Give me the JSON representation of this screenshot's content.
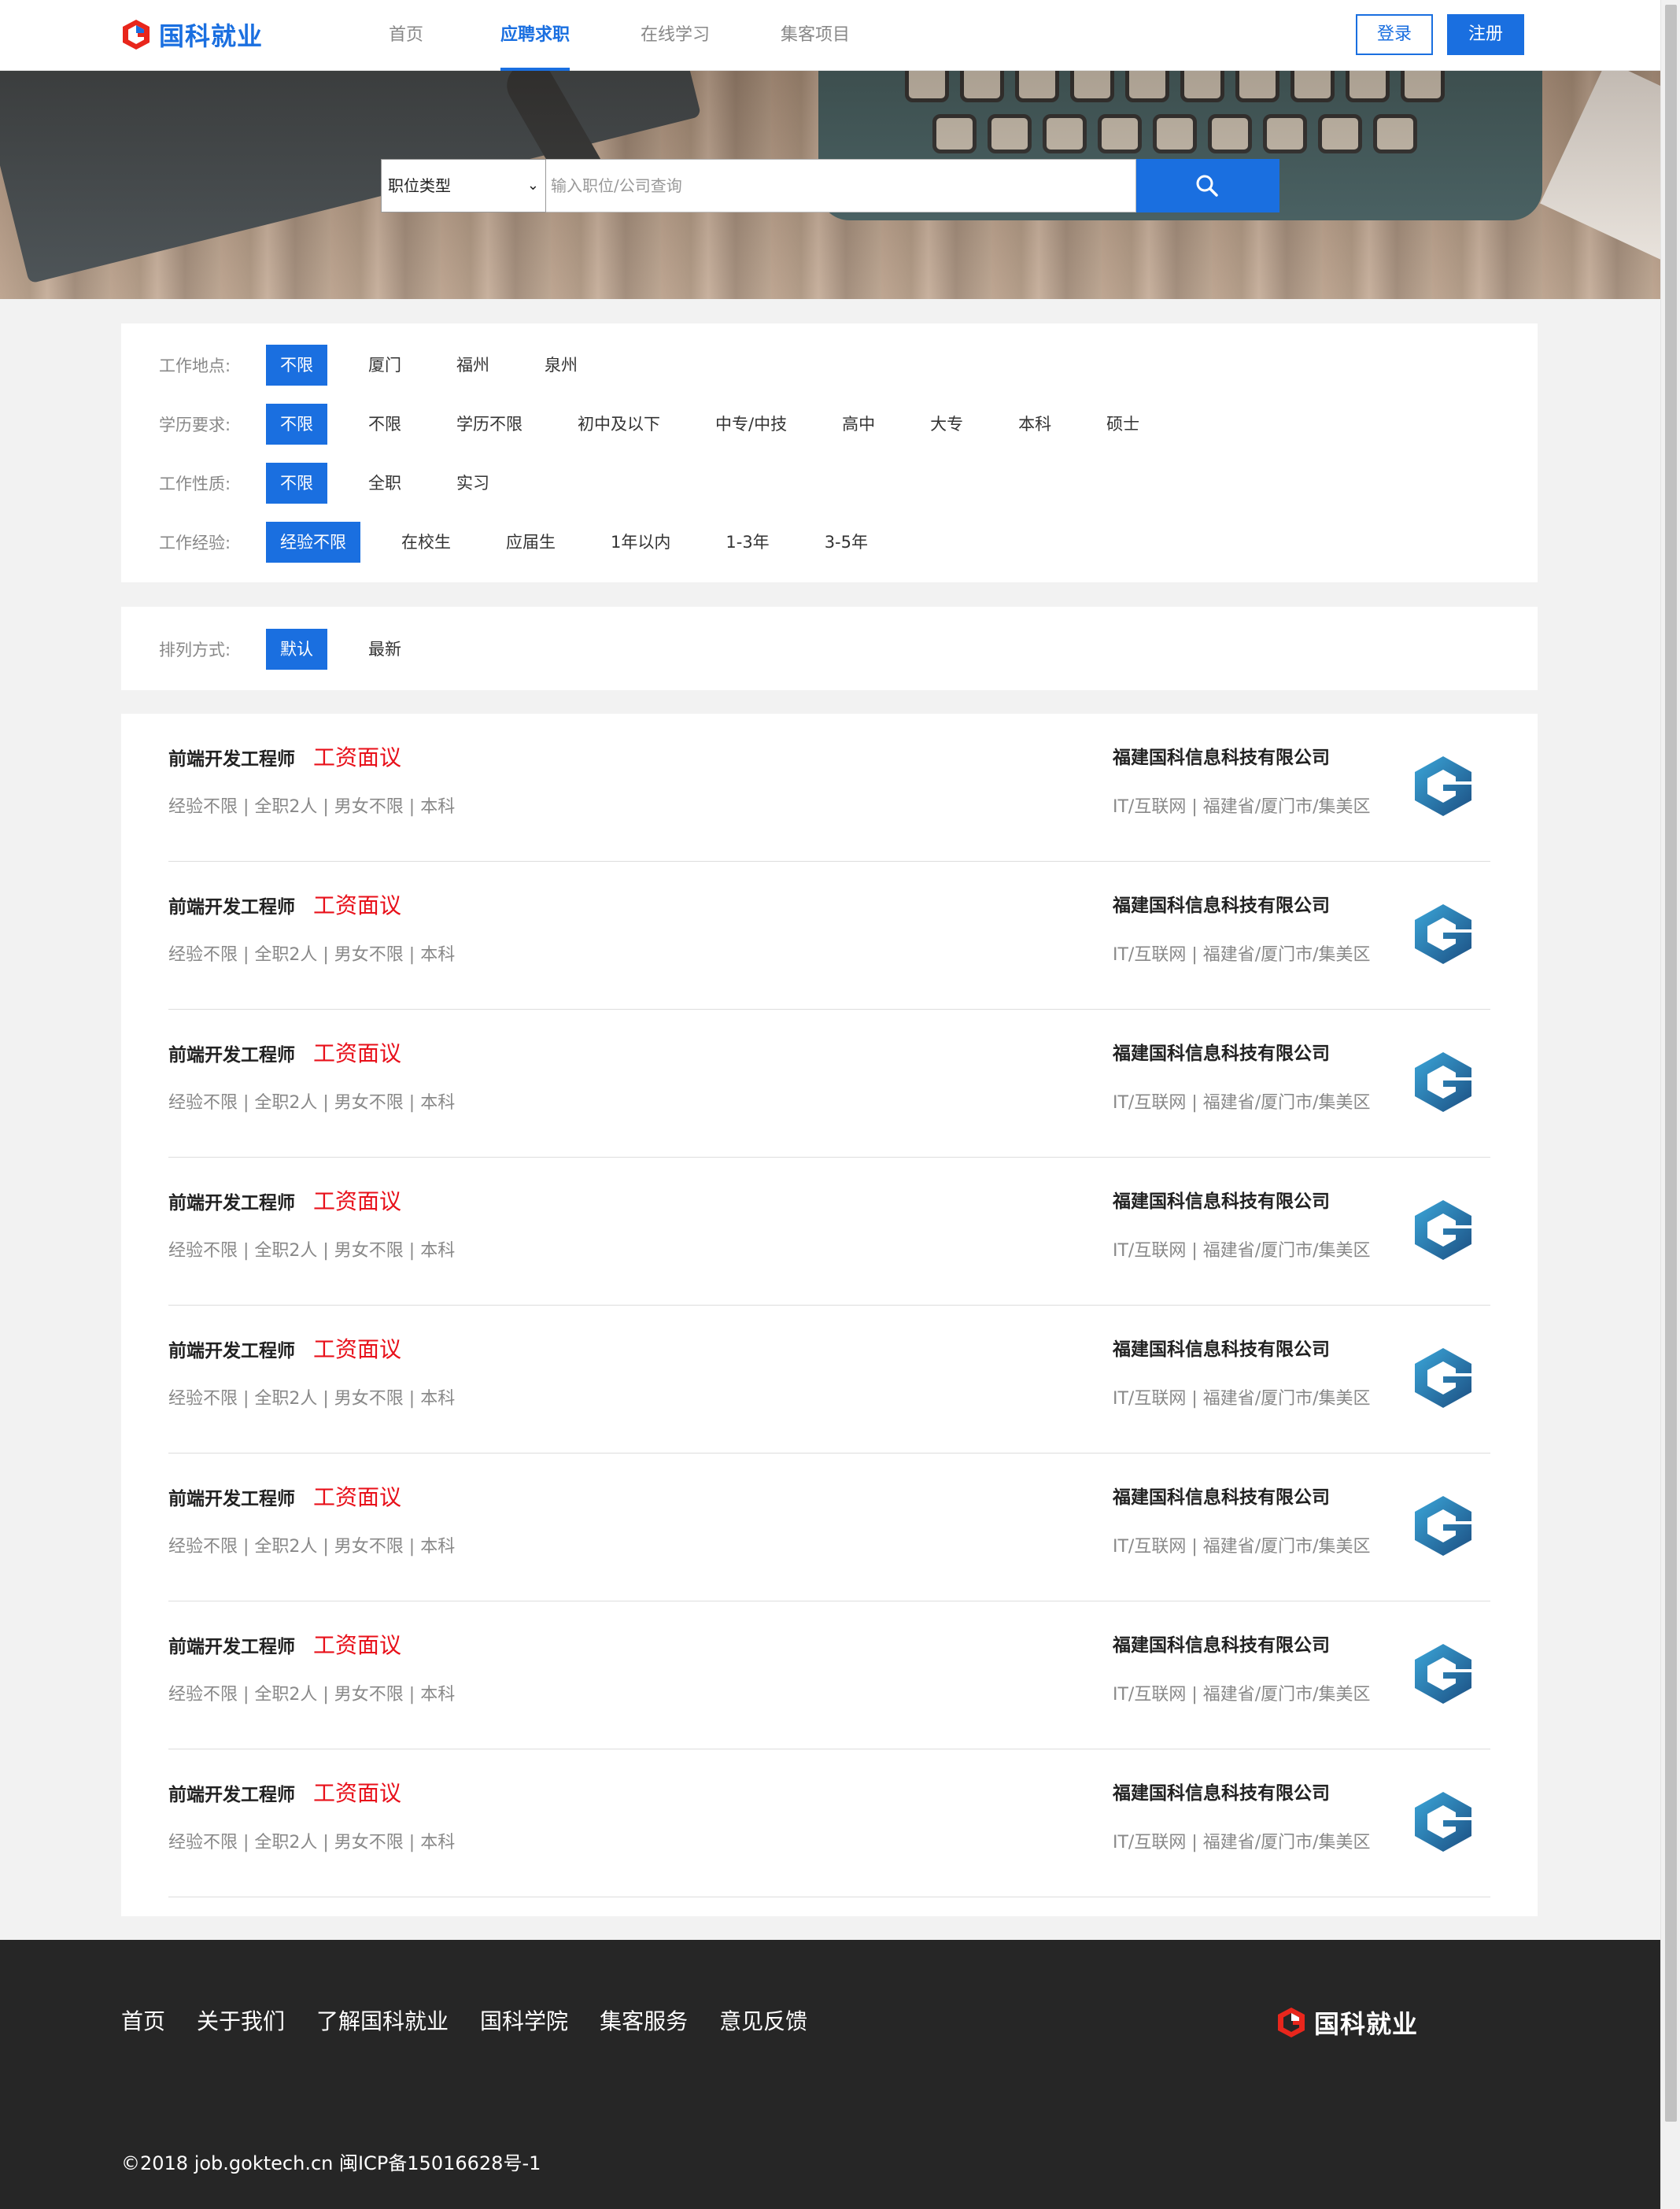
{
  "header": {
    "brand": "国科就业",
    "nav": [
      {
        "label": "首页",
        "active": false
      },
      {
        "label": "应聘求职",
        "active": true
      },
      {
        "label": "在线学习",
        "active": false
      },
      {
        "label": "集客项目",
        "active": false
      }
    ],
    "login_label": "登录",
    "register_label": "注册"
  },
  "search": {
    "category_selected": "职位类型",
    "placeholder": "输入职位/公司查询"
  },
  "filters": {
    "location": {
      "label": "工作地点:",
      "options": [
        "不限",
        "厦门",
        "福州",
        "泉州"
      ],
      "selected": "不限"
    },
    "education": {
      "label": "学历要求:",
      "options": [
        "不限",
        "不限",
        "学历不限",
        "初中及以下",
        "中专/中技",
        "高中",
        "大专",
        "本科",
        "硕士"
      ],
      "selected": "不限"
    },
    "nature": {
      "label": "工作性质:",
      "options": [
        "不限",
        "全职",
        "实习"
      ],
      "selected": "不限"
    },
    "experience": {
      "label": "工作经验:",
      "options": [
        "经验不限",
        "在校生",
        "应届生",
        "1年以内",
        "1-3年",
        "3-5年"
      ],
      "selected": "经验不限"
    }
  },
  "sort": {
    "label": "排列方式:",
    "options": [
      "默认",
      "最新"
    ],
    "selected": "默认"
  },
  "jobs": [
    {
      "title": "前端开发工程师",
      "salary": "工资面议",
      "meta": "经验不限 | 全职2人 | 男女不限 | 本科",
      "company": "福建国科信息科技有限公司",
      "company_meta": "IT/互联网 | 福建省/厦门市/集美区"
    },
    {
      "title": "前端开发工程师",
      "salary": "工资面议",
      "meta": "经验不限 | 全职2人 | 男女不限 | 本科",
      "company": "福建国科信息科技有限公司",
      "company_meta": "IT/互联网 | 福建省/厦门市/集美区"
    },
    {
      "title": "前端开发工程师",
      "salary": "工资面议",
      "meta": "经验不限 | 全职2人 | 男女不限 | 本科",
      "company": "福建国科信息科技有限公司",
      "company_meta": "IT/互联网 | 福建省/厦门市/集美区"
    },
    {
      "title": "前端开发工程师",
      "salary": "工资面议",
      "meta": "经验不限 | 全职2人 | 男女不限 | 本科",
      "company": "福建国科信息科技有限公司",
      "company_meta": "IT/互联网 | 福建省/厦门市/集美区"
    },
    {
      "title": "前端开发工程师",
      "salary": "工资面议",
      "meta": "经验不限 | 全职2人 | 男女不限 | 本科",
      "company": "福建国科信息科技有限公司",
      "company_meta": "IT/互联网 | 福建省/厦门市/集美区"
    },
    {
      "title": "前端开发工程师",
      "salary": "工资面议",
      "meta": "经验不限 | 全职2人 | 男女不限 | 本科",
      "company": "福建国科信息科技有限公司",
      "company_meta": "IT/互联网 | 福建省/厦门市/集美区"
    },
    {
      "title": "前端开发工程师",
      "salary": "工资面议",
      "meta": "经验不限 | 全职2人 | 男女不限 | 本科",
      "company": "福建国科信息科技有限公司",
      "company_meta": "IT/互联网 | 福建省/厦门市/集美区"
    },
    {
      "title": "前端开发工程师",
      "salary": "工资面议",
      "meta": "经验不限 | 全职2人 | 男女不限 | 本科",
      "company": "福建国科信息科技有限公司",
      "company_meta": "IT/互联网 | 福建省/厦门市/集美区"
    }
  ],
  "footer": {
    "links": [
      "首页",
      "关于我们",
      "了解国科就业",
      "国科学院",
      "集客服务",
      "意见反馈"
    ],
    "brand": "国科就业",
    "copyright": "©2018 job.goktech.cn 闽ICP备15016628号-1"
  },
  "colors": {
    "accent": "#1a6fe0",
    "salary": "#e8101a",
    "footer_bg": "#262626",
    "logo_red": "#e8261c"
  },
  "icons": {
    "search": "search-icon",
    "logo": "g-logo-icon",
    "dropdown": "chevron-down-icon"
  }
}
